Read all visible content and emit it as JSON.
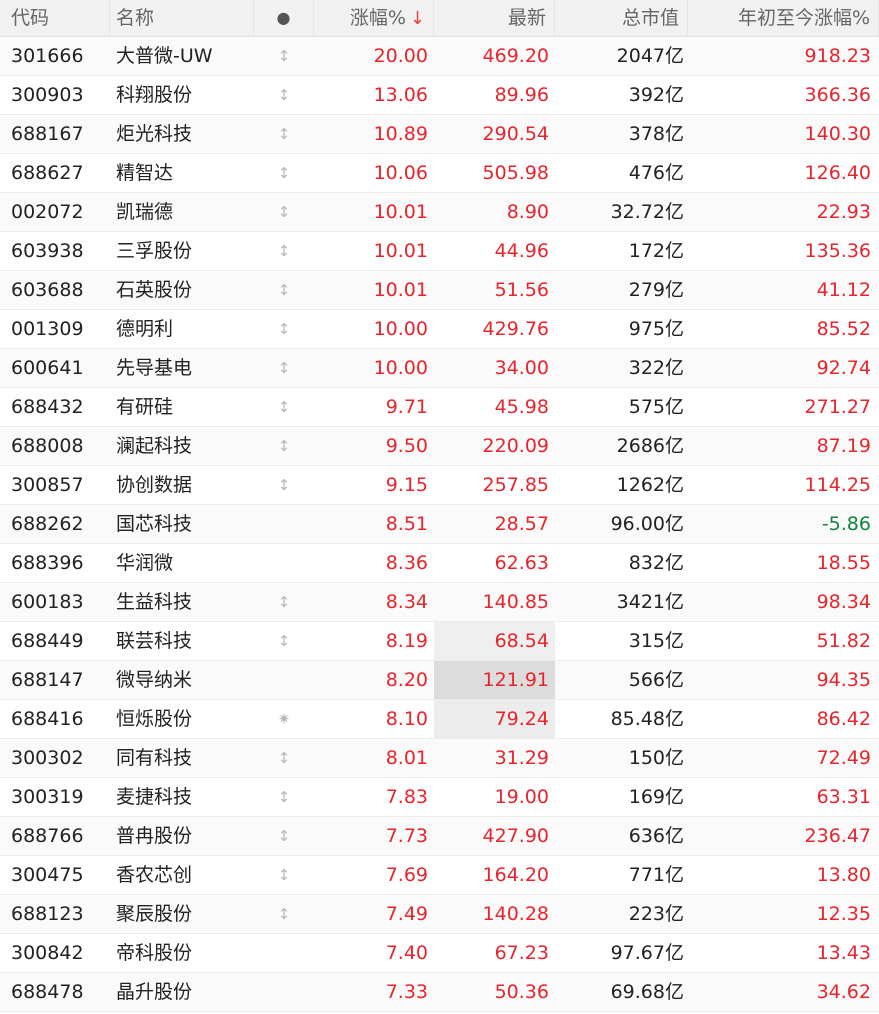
{
  "header": {
    "code": "代码",
    "name": "名称",
    "dot": "●",
    "change": "涨幅%",
    "sort_arrow": "↓",
    "price": "最新",
    "mcap": "总市值",
    "ytd": "年初至今涨幅%"
  },
  "colors": {
    "up": "#e8242c",
    "down": "#11853b",
    "header_bg": "#f1f1f1"
  },
  "rows": [
    {
      "code": "301666",
      "name": "大普微-UW",
      "mark": "↕",
      "change": "20.00",
      "price": "469.20",
      "mcap": "2047亿",
      "ytd": "918.23"
    },
    {
      "code": "300903",
      "name": "科翔股份",
      "mark": "↕",
      "change": "13.06",
      "price": "89.96",
      "mcap": "392亿",
      "ytd": "366.36"
    },
    {
      "code": "688167",
      "name": "炬光科技",
      "mark": "↕",
      "change": "10.89",
      "price": "290.54",
      "mcap": "378亿",
      "ytd": "140.30"
    },
    {
      "code": "688627",
      "name": "精智达",
      "mark": "↕",
      "change": "10.06",
      "price": "505.98",
      "mcap": "476亿",
      "ytd": "126.40"
    },
    {
      "code": "002072",
      "name": "凯瑞德",
      "mark": "↕",
      "change": "10.01",
      "price": "8.90",
      "mcap": "32.72亿",
      "ytd": "22.93"
    },
    {
      "code": "603938",
      "name": "三孚股份",
      "mark": "↕",
      "change": "10.01",
      "price": "44.96",
      "mcap": "172亿",
      "ytd": "135.36"
    },
    {
      "code": "603688",
      "name": "石英股份",
      "mark": "↕",
      "change": "10.01",
      "price": "51.56",
      "mcap": "279亿",
      "ytd": "41.12"
    },
    {
      "code": "001309",
      "name": "德明利",
      "mark": "↕",
      "change": "10.00",
      "price": "429.76",
      "mcap": "975亿",
      "ytd": "85.52"
    },
    {
      "code": "600641",
      "name": "先导基电",
      "mark": "↕",
      "change": "10.00",
      "price": "34.00",
      "mcap": "322亿",
      "ytd": "92.74"
    },
    {
      "code": "688432",
      "name": "有研硅",
      "mark": "↕",
      "change": "9.71",
      "price": "45.98",
      "mcap": "575亿",
      "ytd": "271.27"
    },
    {
      "code": "688008",
      "name": "澜起科技",
      "mark": "↕",
      "change": "9.50",
      "price": "220.09",
      "mcap": "2686亿",
      "ytd": "87.19"
    },
    {
      "code": "300857",
      "name": "协创数据",
      "mark": "↕",
      "change": "9.15",
      "price": "257.85",
      "mcap": "1262亿",
      "ytd": "114.25"
    },
    {
      "code": "688262",
      "name": "国芯科技",
      "mark": "",
      "change": "8.51",
      "price": "28.57",
      "mcap": "96.00亿",
      "ytd": "-5.86"
    },
    {
      "code": "688396",
      "name": "华润微",
      "mark": "",
      "change": "8.36",
      "price": "62.63",
      "mcap": "832亿",
      "ytd": "18.55"
    },
    {
      "code": "600183",
      "name": "生益科技",
      "mark": "↕",
      "change": "8.34",
      "price": "140.85",
      "mcap": "3421亿",
      "ytd": "98.34"
    },
    {
      "code": "688449",
      "name": "联芸科技",
      "mark": "↕",
      "change": "8.19",
      "price": "68.54",
      "mcap": "315亿",
      "ytd": "51.82"
    },
    {
      "code": "688147",
      "name": "微导纳米",
      "mark": "",
      "change": "8.20",
      "price": "121.91",
      "mcap": "566亿",
      "ytd": "94.35"
    },
    {
      "code": "688416",
      "name": "恒烁股份",
      "mark": "✷",
      "change": "8.10",
      "price": "79.24",
      "mcap": "85.48亿",
      "ytd": "86.42"
    },
    {
      "code": "300302",
      "name": "同有科技",
      "mark": "↕",
      "change": "8.01",
      "price": "31.29",
      "mcap": "150亿",
      "ytd": "72.49"
    },
    {
      "code": "300319",
      "name": "麦捷科技",
      "mark": "↕",
      "change": "7.83",
      "price": "19.00",
      "mcap": "169亿",
      "ytd": "63.31"
    },
    {
      "code": "688766",
      "name": "普冉股份",
      "mark": "↕",
      "change": "7.73",
      "price": "427.90",
      "mcap": "636亿",
      "ytd": "236.47"
    },
    {
      "code": "300475",
      "name": "香农芯创",
      "mark": "↕",
      "change": "7.69",
      "price": "164.20",
      "mcap": "771亿",
      "ytd": "13.80"
    },
    {
      "code": "688123",
      "name": "聚辰股份",
      "mark": "↕",
      "change": "7.49",
      "price": "140.28",
      "mcap": "223亿",
      "ytd": "12.35"
    },
    {
      "code": "300842",
      "name": "帝科股份",
      "mark": "",
      "change": "7.40",
      "price": "67.23",
      "mcap": "97.67亿",
      "ytd": "13.43"
    },
    {
      "code": "688478",
      "name": "晶升股份",
      "mark": "",
      "change": "7.33",
      "price": "50.36",
      "mcap": "69.68亿",
      "ytd": "34.62"
    }
  ]
}
